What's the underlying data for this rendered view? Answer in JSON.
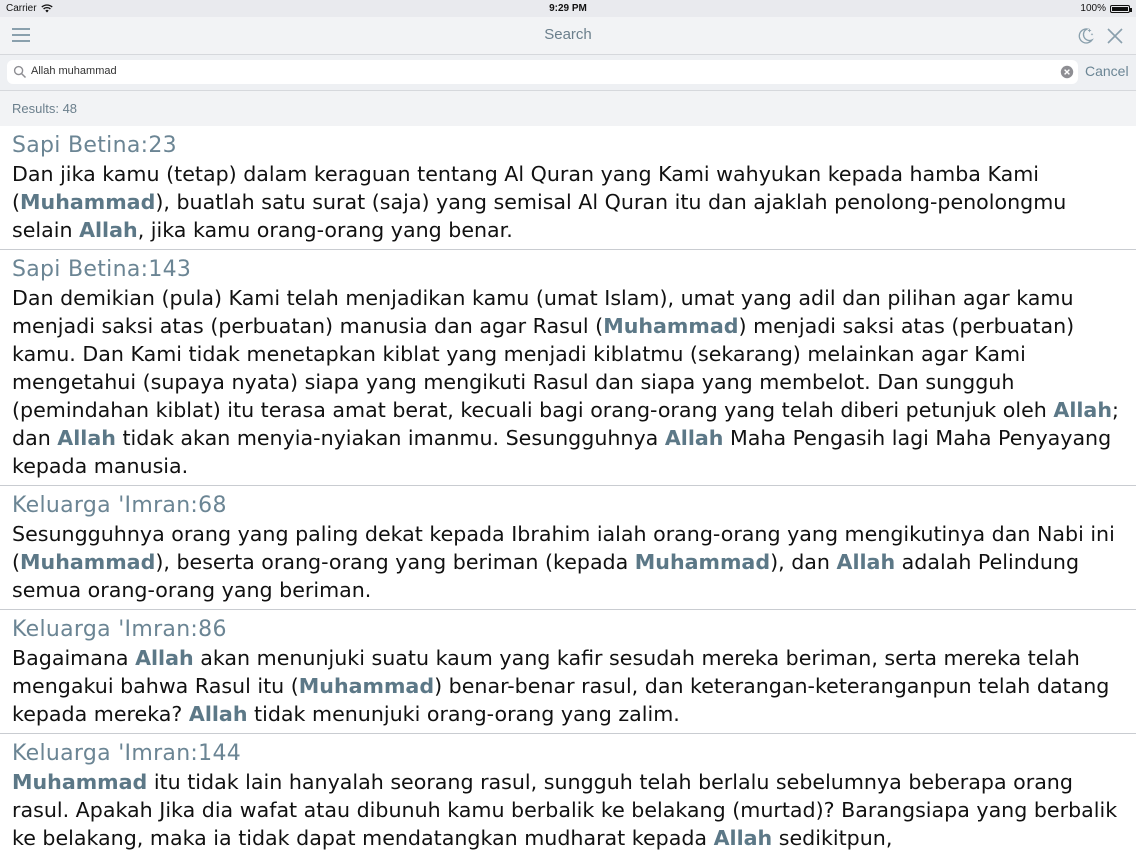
{
  "status_bar": {
    "carrier": "Carrier",
    "time": "9:29 PM",
    "battery": "100%",
    "battery_level": 1.0
  },
  "navbar": {
    "title": "Search",
    "icons": [
      "menu-icon",
      "night-mode-icon",
      "close-icon"
    ]
  },
  "search": {
    "query": "Allah muhammad",
    "cancel_label": "Cancel"
  },
  "results": {
    "label": "Results: 48"
  },
  "colors": {
    "accent": "#6b8594",
    "highlight": "#5c7887",
    "bar_bg": "#f2f3f5",
    "divider": "#c9ccd1"
  },
  "items": [
    {
      "ref": "Sapi Betina:23",
      "segments": [
        {
          "t": "Dan jika kamu (tetap) dalam keraguan tentang Al Quran yang Kami wahyukan kepada hamba Kami ("
        },
        {
          "t": "Muhammad",
          "hl": true
        },
        {
          "t": "), buatlah satu surat (saja) yang semisal Al Quran itu dan ajaklah penolong-penolongmu selain "
        },
        {
          "t": "Allah",
          "hl": true
        },
        {
          "t": ", jika kamu orang-orang yang benar."
        }
      ]
    },
    {
      "ref": "Sapi Betina:143",
      "segments": [
        {
          "t": "Dan demikian (pula) Kami telah menjadikan kamu (umat Islam), umat yang adil dan pilihan agar kamu menjadi saksi atas (perbuatan) manusia dan agar Rasul ("
        },
        {
          "t": "Muhammad",
          "hl": true
        },
        {
          "t": ") menjadi saksi atas (perbuatan) kamu. Dan Kami tidak menetapkan kiblat yang menjadi kiblatmu (sekarang) melainkan agar Kami mengetahui (supaya nyata) siapa yang mengikuti Rasul dan siapa yang membelot. Dan sungguh (pemindahan kiblat) itu terasa amat berat, kecuali bagi orang-orang yang telah diberi petunjuk oleh "
        },
        {
          "t": "Allah",
          "hl": true
        },
        {
          "t": "; dan "
        },
        {
          "t": "Allah",
          "hl": true
        },
        {
          "t": " tidak akan menyia-nyiakan imanmu. Sesungguhnya "
        },
        {
          "t": "Allah",
          "hl": true
        },
        {
          "t": " Maha Pengasih lagi Maha Penyayang kepada manusia."
        }
      ]
    },
    {
      "ref": "Keluarga 'Imran:68",
      "segments": [
        {
          "t": "Sesungguhnya orang yang paling dekat kepada Ibrahim ialah orang-orang yang mengikutinya dan Nabi ini ("
        },
        {
          "t": "Muhammad",
          "hl": true
        },
        {
          "t": "), beserta orang-orang yang beriman (kepada "
        },
        {
          "t": "Muhammad",
          "hl": true
        },
        {
          "t": "), dan "
        },
        {
          "t": "Allah",
          "hl": true
        },
        {
          "t": " adalah Pelindung semua orang-orang yang beriman."
        }
      ]
    },
    {
      "ref": "Keluarga 'Imran:86",
      "segments": [
        {
          "t": "Bagaimana "
        },
        {
          "t": "Allah",
          "hl": true
        },
        {
          "t": " akan menunjuki suatu kaum yang kafir sesudah mereka beriman, serta mereka telah mengakui bahwa Rasul itu ("
        },
        {
          "t": "Muhammad",
          "hl": true
        },
        {
          "t": ") benar-benar rasul, dan keterangan-keteranganpun telah datang kepada mereka? "
        },
        {
          "t": "Allah",
          "hl": true
        },
        {
          "t": " tidak menunjuki orang-orang yang zalim."
        }
      ]
    },
    {
      "ref": "Keluarga 'Imran:144",
      "segments": [
        {
          "t": "Muhammad",
          "hl": true
        },
        {
          "t": " itu tidak lain hanyalah seorang rasul, sungguh telah berlalu sebelumnya beberapa orang rasul. Apakah Jika dia wafat atau dibunuh kamu berbalik ke belakang (murtad)? Barangsiapa yang berbalik ke belakang, maka ia tidak dapat mendatangkan mudharat kepada "
        },
        {
          "t": "Allah",
          "hl": true
        },
        {
          "t": " sedikitpun,"
        }
      ]
    }
  ]
}
